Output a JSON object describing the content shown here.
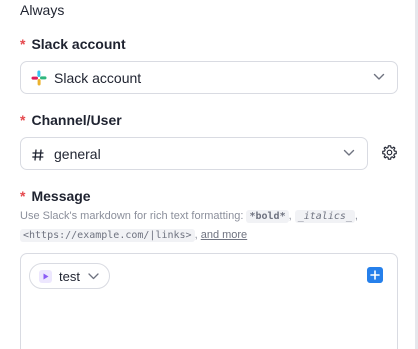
{
  "previous_field": {
    "value": "Always"
  },
  "slack_account": {
    "required_mark": "*",
    "label": "Slack account",
    "value": "Slack account",
    "icon": "slack-logo-icon"
  },
  "channel_user": {
    "required_mark": "*",
    "label": "Channel/User",
    "value": "general",
    "icon": "hash-icon"
  },
  "message": {
    "required_mark": "*",
    "label": "Message",
    "hint_intro": "Use Slack's markdown for rich text formatting:",
    "hint_bold": "*bold*",
    "hint_italics": "_italics_",
    "hint_link": "<https://example.com/|links>",
    "hint_more": "and more",
    "sep": ",",
    "token_label": "test",
    "token_icon": "play-icon",
    "add_icon": "plus-icon"
  },
  "colors": {
    "required": "#e5484d",
    "accent": "#2680eb",
    "token_icon": "#8b5cf6"
  }
}
